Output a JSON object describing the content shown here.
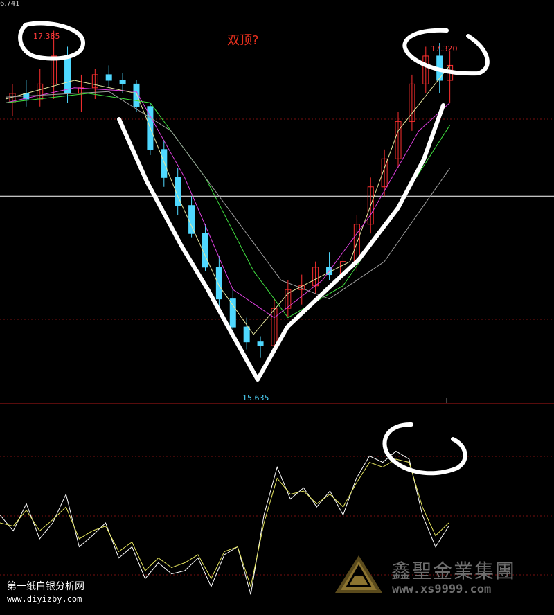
{
  "chart_data": [
    {
      "type": "candlestick",
      "y_axis_visible_tick": "6.741",
      "ylim": [
        15.4,
        17.55
      ],
      "horizontal_reference_line": 16.5,
      "annotation": "双顶?",
      "high_label": "17.385",
      "high": 17.385,
      "second_high_label": "17.320",
      "second_high": 17.32,
      "low_label": "15.635",
      "low": 15.635,
      "x_range": [
        0,
        160
      ],
      "candles_approx": [
        {
          "x": 2,
          "o": 17.0,
          "h": 17.1,
          "l": 16.93,
          "c": 17.05
        },
        {
          "x": 6,
          "o": 17.05,
          "h": 17.12,
          "l": 16.98,
          "c": 17.02
        },
        {
          "x": 10,
          "o": 17.02,
          "h": 17.18,
          "l": 16.98,
          "c": 17.1
        },
        {
          "x": 14,
          "o": 17.1,
          "h": 17.385,
          "l": 17.02,
          "c": 17.25
        },
        {
          "x": 18,
          "o": 17.25,
          "h": 17.3,
          "l": 17.0,
          "c": 17.05
        },
        {
          "x": 22,
          "o": 17.05,
          "h": 17.15,
          "l": 16.95,
          "c": 17.08
        },
        {
          "x": 26,
          "o": 17.08,
          "h": 17.18,
          "l": 17.02,
          "c": 17.15
        },
        {
          "x": 30,
          "o": 17.15,
          "h": 17.2,
          "l": 17.08,
          "c": 17.12
        },
        {
          "x": 34,
          "o": 17.12,
          "h": 17.16,
          "l": 17.05,
          "c": 17.1
        },
        {
          "x": 38,
          "o": 17.1,
          "h": 17.12,
          "l": 16.95,
          "c": 16.98
        },
        {
          "x": 42,
          "o": 16.98,
          "h": 17.0,
          "l": 16.72,
          "c": 16.75
        },
        {
          "x": 46,
          "o": 16.75,
          "h": 16.8,
          "l": 16.55,
          "c": 16.6
        },
        {
          "x": 50,
          "o": 16.6,
          "h": 16.65,
          "l": 16.4,
          "c": 16.45
        },
        {
          "x": 54,
          "o": 16.45,
          "h": 16.5,
          "l": 16.28,
          "c": 16.3
        },
        {
          "x": 58,
          "o": 16.3,
          "h": 16.35,
          "l": 16.1,
          "c": 16.12
        },
        {
          "x": 62,
          "o": 16.12,
          "h": 16.18,
          "l": 15.9,
          "c": 15.95
        },
        {
          "x": 66,
          "o": 15.95,
          "h": 16.0,
          "l": 15.75,
          "c": 15.8
        },
        {
          "x": 70,
          "o": 15.8,
          "h": 15.85,
          "l": 15.68,
          "c": 15.72
        },
        {
          "x": 74,
          "o": 15.72,
          "h": 15.75,
          "l": 15.635,
          "c": 15.7
        },
        {
          "x": 78,
          "o": 15.7,
          "h": 15.95,
          "l": 15.66,
          "c": 15.9
        },
        {
          "x": 82,
          "o": 15.9,
          "h": 16.05,
          "l": 15.85,
          "c": 16.0
        },
        {
          "x": 86,
          "o": 16.0,
          "h": 16.08,
          "l": 15.92,
          "c": 16.02
        },
        {
          "x": 90,
          "o": 16.02,
          "h": 16.15,
          "l": 15.98,
          "c": 16.12
        },
        {
          "x": 94,
          "o": 16.12,
          "h": 16.2,
          "l": 16.05,
          "c": 16.08
        },
        {
          "x": 98,
          "o": 16.08,
          "h": 16.18,
          "l": 16.0,
          "c": 16.15
        },
        {
          "x": 102,
          "o": 16.15,
          "h": 16.4,
          "l": 16.1,
          "c": 16.35
        },
        {
          "x": 106,
          "o": 16.35,
          "h": 16.6,
          "l": 16.3,
          "c": 16.55
        },
        {
          "x": 110,
          "o": 16.55,
          "h": 16.75,
          "l": 16.5,
          "c": 16.7
        },
        {
          "x": 114,
          "o": 16.7,
          "h": 16.95,
          "l": 16.65,
          "c": 16.9
        },
        {
          "x": 118,
          "o": 16.9,
          "h": 17.15,
          "l": 16.85,
          "c": 17.1
        },
        {
          "x": 122,
          "o": 17.1,
          "h": 17.3,
          "l": 17.05,
          "c": 17.25
        },
        {
          "x": 126,
          "o": 17.25,
          "h": 17.32,
          "l": 17.05,
          "c": 17.12
        },
        {
          "x": 129,
          "o": 17.12,
          "h": 17.28,
          "l": 17.0,
          "c": 17.2
        }
      ],
      "moving_averages": [
        {
          "color": "#e8e8a0",
          "values": [
            [
              0,
              17.02
            ],
            [
              20,
              17.12
            ],
            [
              38,
              17.05
            ],
            [
              50,
              16.5
            ],
            [
              62,
              16.02
            ],
            [
              72,
              15.76
            ],
            [
              82,
              15.98
            ],
            [
              100,
              16.15
            ],
            [
              114,
              16.85
            ],
            [
              129,
              17.2
            ]
          ]
        },
        {
          "color": "#e040e0",
          "values": [
            [
              0,
              17.0
            ],
            [
              20,
              17.08
            ],
            [
              38,
              17.06
            ],
            [
              52,
              16.6
            ],
            [
              66,
              16.0
            ],
            [
              78,
              15.85
            ],
            [
              92,
              16.05
            ],
            [
              106,
              16.4
            ],
            [
              120,
              16.85
            ],
            [
              129,
              17.0
            ]
          ]
        },
        {
          "color": "#40e040",
          "values": [
            [
              0,
              17.0
            ],
            [
              24,
              17.05
            ],
            [
              42,
              17.0
            ],
            [
              58,
              16.6
            ],
            [
              72,
              16.1
            ],
            [
              82,
              15.85
            ],
            [
              98,
              16.02
            ],
            [
              114,
              16.45
            ],
            [
              129,
              16.88
            ]
          ]
        },
        {
          "color": "#a0a0a0",
          "values": [
            [
              0,
              17.03
            ],
            [
              30,
              17.06
            ],
            [
              48,
              16.85
            ],
            [
              64,
              16.45
            ],
            [
              80,
              16.05
            ],
            [
              94,
              15.95
            ],
            [
              110,
              16.15
            ],
            [
              129,
              16.65
            ]
          ]
        }
      ]
    },
    {
      "type": "line",
      "panel": "oscillator",
      "series": [
        {
          "color": "#ffffff",
          "values": [
            0.55,
            0.45,
            0.62,
            0.4,
            0.5,
            0.68,
            0.35,
            0.42,
            0.5,
            0.28,
            0.35,
            0.15,
            0.25,
            0.18,
            0.2,
            0.28,
            0.1,
            0.3,
            0.35,
            0.05,
            0.55,
            0.85,
            0.65,
            0.72,
            0.6,
            0.7,
            0.55,
            0.78,
            0.92,
            0.88,
            0.95,
            0.9,
            0.55,
            0.35,
            0.48
          ]
        },
        {
          "color": "#e8e860",
          "values": [
            0.5,
            0.48,
            0.58,
            0.45,
            0.52,
            0.6,
            0.4,
            0.45,
            0.48,
            0.32,
            0.38,
            0.2,
            0.28,
            0.22,
            0.25,
            0.3,
            0.15,
            0.32,
            0.35,
            0.1,
            0.5,
            0.78,
            0.68,
            0.7,
            0.62,
            0.68,
            0.6,
            0.75,
            0.88,
            0.85,
            0.9,
            0.88,
            0.6,
            0.42,
            0.5
          ]
        }
      ]
    }
  ],
  "watermark": {
    "site_name": "第一纸白银分析网",
    "site_url": "www.diyizby.com",
    "brand_name": "鑫聖金業集團",
    "brand_url": "www.xs9999.com"
  }
}
